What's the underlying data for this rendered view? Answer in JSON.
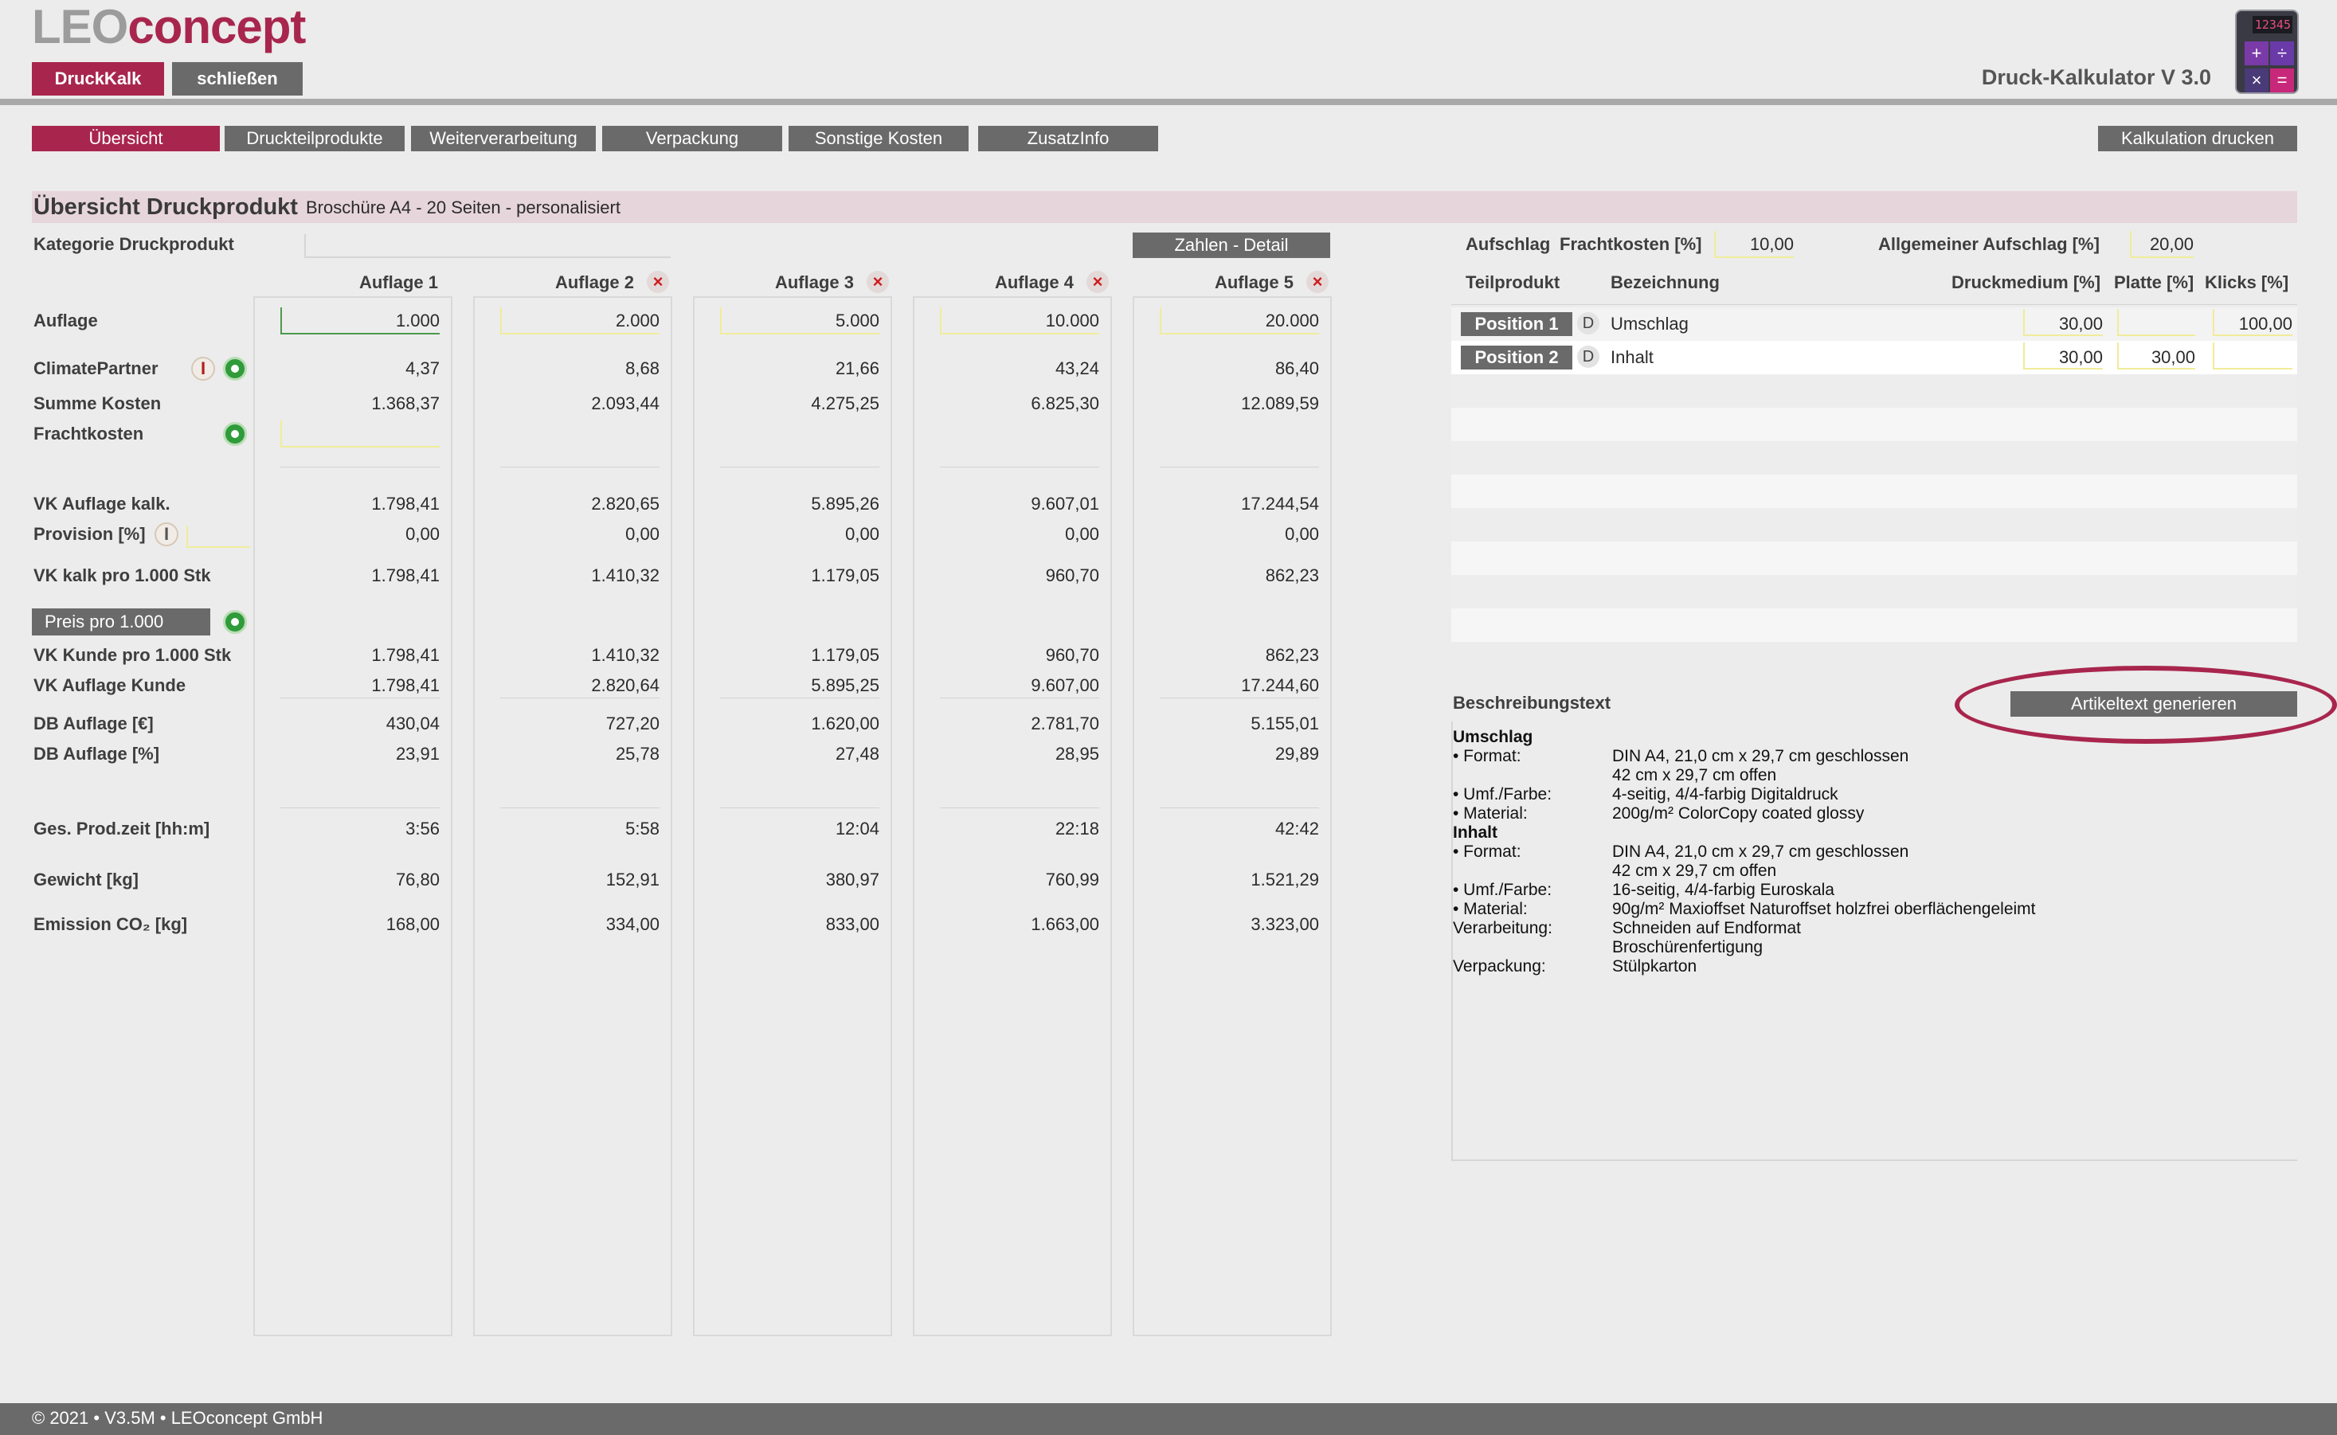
{
  "header": {
    "logo_leo": "LEO",
    "logo_concept": "concept",
    "btn_druckkalk": "DruckKalk",
    "btn_schliessen": "schließen",
    "app_title": "Druck-Kalkulator V 3.0",
    "calc_display": "12345",
    "calc_keys": [
      "+",
      "÷",
      "×",
      "="
    ]
  },
  "nav": {
    "tabs": [
      "Übersicht",
      "Druckteilprodukte",
      "Weiterverarbeitung",
      "Verpackung",
      "Sonstige Kosten",
      "ZusatzInfo"
    ],
    "active": "Übersicht",
    "print_btn": "Kalkulation drucken"
  },
  "section": {
    "title": "Übersicht Druckprodukt",
    "subtitle": "Broschüre A4 - 20 Seiten - personalisiert",
    "kategorie_label": "Kategorie Druckprodukt",
    "zahlen_btn": "Zahlen - Detail",
    "preis_btn": "Preis pro 1.000"
  },
  "labels": {
    "auflage": "Auflage",
    "climate": "ClimatePartner",
    "summe": "Summe Kosten",
    "fracht": "Frachtkosten",
    "vk_auflage_kalk": "VK Auflage kalk.",
    "provision": "Provision [%]",
    "vk_kalk_1000": "VK kalk pro 1.000 Stk",
    "vk_kunde_1000": "VK Kunde pro 1.000 Stk",
    "vk_auflage_kunde": "VK Auflage Kunde",
    "db_eur": "DB Auflage [€]",
    "db_pct": "DB Auflage [%]",
    "prodzeit": "Ges. Prod.zeit [hh:m]",
    "gewicht": "Gewicht [kg]",
    "emission": "Emission CO₂ [kg]"
  },
  "columns": [
    {
      "header": "Auflage 1",
      "auflage": "1.000",
      "climate": "4,37",
      "summe": "1.368,37",
      "vk_auflage_kalk": "1.798,41",
      "provision": "0,00",
      "vk_kalk_1000": "1.798,41",
      "vk_kunde_1000": "1.798,41",
      "vk_auflage_kunde": "1.798,41",
      "db_eur": "430,04",
      "db_pct": "23,91",
      "prodzeit": "3:56",
      "gewicht": "76,80",
      "emission": "168,00"
    },
    {
      "header": "Auflage 2",
      "auflage": "2.000",
      "climate": "8,68",
      "summe": "2.093,44",
      "vk_auflage_kalk": "2.820,65",
      "provision": "0,00",
      "vk_kalk_1000": "1.410,32",
      "vk_kunde_1000": "1.410,32",
      "vk_auflage_kunde": "2.820,64",
      "db_eur": "727,20",
      "db_pct": "25,78",
      "prodzeit": "5:58",
      "gewicht": "152,91",
      "emission": "334,00"
    },
    {
      "header": "Auflage 3",
      "auflage": "5.000",
      "climate": "21,66",
      "summe": "4.275,25",
      "vk_auflage_kalk": "5.895,26",
      "provision": "0,00",
      "vk_kalk_1000": "1.179,05",
      "vk_kunde_1000": "1.179,05",
      "vk_auflage_kunde": "5.895,25",
      "db_eur": "1.620,00",
      "db_pct": "27,48",
      "prodzeit": "12:04",
      "gewicht": "380,97",
      "emission": "833,00"
    },
    {
      "header": "Auflage 4",
      "auflage": "10.000",
      "climate": "43,24",
      "summe": "6.825,30",
      "vk_auflage_kalk": "9.607,01",
      "provision": "0,00",
      "vk_kalk_1000": "960,70",
      "vk_kunde_1000": "960,70",
      "vk_auflage_kunde": "9.607,00",
      "db_eur": "2.781,70",
      "db_pct": "28,95",
      "prodzeit": "22:18",
      "gewicht": "760,99",
      "emission": "1.663,00"
    },
    {
      "header": "Auflage 5",
      "auflage": "20.000",
      "climate": "86,40",
      "summe": "12.089,59",
      "vk_auflage_kalk": "17.244,54",
      "provision": "0,00",
      "vk_kalk_1000": "862,23",
      "vk_kunde_1000": "862,23",
      "vk_auflage_kunde": "17.244,60",
      "db_eur": "5.155,01",
      "db_pct": "29,89",
      "prodzeit": "42:42",
      "gewicht": "1.521,29",
      "emission": "3.323,00"
    }
  ],
  "right": {
    "aufschlag_label": "Aufschlag",
    "fracht_label": "Frachtkosten [%]",
    "fracht_value": "10,00",
    "allg_label": "Allgemeiner Aufschlag [%]",
    "allg_value": "20,00",
    "headers": {
      "teilprodukt": "Teilprodukt",
      "bezeichnung": "Bezeichnung",
      "druckmedium": "Druckmedium [%]",
      "platte": "Platte [%]",
      "klicks": "Klicks [%]"
    },
    "positions": [
      {
        "btn": "Position 1",
        "d": "D",
        "name": "Umschlag",
        "druckmedium": "30,00",
        "platte": "",
        "klicks": "100,00"
      },
      {
        "btn": "Position 2",
        "d": "D",
        "name": "Inhalt",
        "druckmedium": "30,00",
        "platte": "30,00",
        "klicks": ""
      }
    ],
    "beschreibung_label": "Beschreibungstext",
    "gen_btn": "Artikeltext generieren"
  },
  "description": [
    {
      "k": "Umschlag",
      "v": "",
      "bold": true
    },
    {
      "k": "• Format:",
      "v": "DIN A4, 21,0 cm x 29,7 cm geschlossen"
    },
    {
      "k": "",
      "v": "42 cm x 29,7 cm offen"
    },
    {
      "k": "• Umf./Farbe:",
      "v": "4-seitig, 4/4-farbig Digitaldruck"
    },
    {
      "k": "• Material:",
      "v": "200g/m² ColorCopy coated glossy"
    },
    {
      "k": "Inhalt",
      "v": "",
      "bold": true
    },
    {
      "k": "• Format:",
      "v": "DIN A4, 21,0 cm x 29,7 cm geschlossen"
    },
    {
      "k": "",
      "v": "42 cm x 29,7 cm offen"
    },
    {
      "k": "• Umf./Farbe:",
      "v": "16-seitig, 4/4-farbig Euroskala"
    },
    {
      "k": "• Material:",
      "v": "90g/m² Maxioffset Naturoffset holzfrei oberflächengeleimt"
    },
    {
      "k": "Verarbeitung:",
      "v": "Schneiden auf Endformat"
    },
    {
      "k": "",
      "v": "Broschürenfertigung"
    },
    {
      "k": "Verpackung:",
      "v": "Stülpkarton"
    }
  ],
  "footer": {
    "text": "© 2021 • V3.5M • LEOconcept GmbH"
  },
  "colors": {
    "accent": "#a8264e",
    "button_grey": "#6a6a6a",
    "background": "#ececec"
  }
}
